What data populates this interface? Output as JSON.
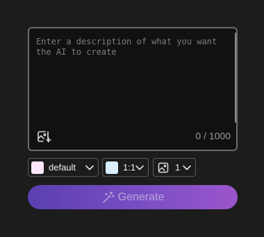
{
  "prompt": {
    "placeholder": "Enter a description of what you want the AI to create",
    "value": "",
    "char_count": "0 / 1000"
  },
  "options": {
    "style": {
      "label": "default",
      "swatch_color": "#fde6fb"
    },
    "ratio": {
      "label": "1:1",
      "swatch_color": "#d8efff"
    },
    "count": {
      "label": "1"
    }
  },
  "generate": {
    "label": "Generate"
  },
  "icons": {
    "image_add": "image-add-icon",
    "chevron": "chevron-down-icon",
    "image": "image-icon",
    "magic_wand": "magic-wand-icon"
  },
  "colors": {
    "background": "#1c1c1c",
    "input_background": "#111111",
    "button_gradient_start": "#5a3fb0",
    "button_gradient_end": "#9b55cc"
  }
}
